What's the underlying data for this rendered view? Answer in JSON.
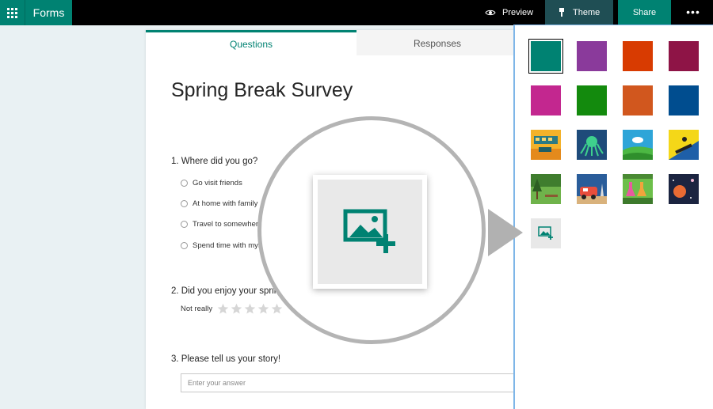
{
  "topbar": {
    "app_name": "Forms",
    "preview_label": "Preview",
    "theme_label": "Theme",
    "share_label": "Share",
    "more_label": "•••"
  },
  "tabs": {
    "questions": "Questions",
    "responses": "Responses"
  },
  "form": {
    "title": "Spring Break Survey",
    "q1": {
      "label": "1. Where did you go?",
      "options": [
        "Go visit friends",
        "At home with family",
        "Travel to somewhere",
        "Spend time with mys"
      ]
    },
    "q2": {
      "label": "2. Did you enjoy your spring",
      "rating_label": "Not really",
      "star_count": 5
    },
    "q3": {
      "label": "3. Please tell us your story!",
      "placeholder": "Enter your answer"
    }
  },
  "themes": {
    "colors": [
      "#008272",
      "#8a3a9b",
      "#d83b01",
      "#8e1446",
      "#c3278f",
      "#138a0d",
      "#d1571e",
      "#004d8f"
    ],
    "image_themes": [
      "theme-picnic",
      "theme-octopus",
      "theme-meadow",
      "theme-snowboard",
      "theme-forest",
      "theme-camper",
      "theme-lab",
      "theme-space"
    ],
    "selected_index": 0
  },
  "colors": {
    "brand": "#008272",
    "panel_border": "#7fb6e8"
  }
}
